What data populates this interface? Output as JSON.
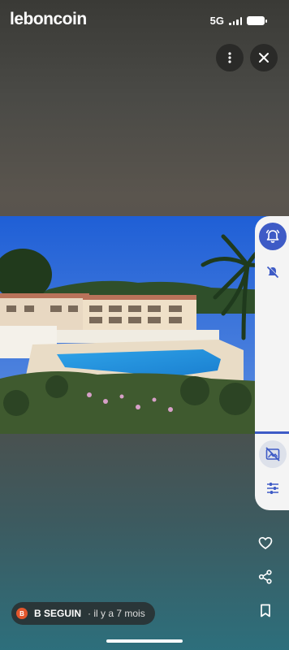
{
  "status_bar": {
    "app_brand": "leboncoin",
    "network": "5G",
    "signal_icon": "signal-bars-icon",
    "battery_icon": "battery-icon"
  },
  "top_controls": {
    "more_icon": "more-vertical-icon",
    "close_icon": "close-icon"
  },
  "photo": {
    "subject": "residence-pool-photo",
    "icon": "photo-image"
  },
  "side_rail": {
    "buttons": [
      {
        "icon": "bell-alarm-icon",
        "active": true
      },
      {
        "icon": "mute-off-icon",
        "active": false
      },
      {
        "icon": "no-image-icon",
        "active": false
      },
      {
        "icon": "sliders-icon",
        "active": false
      }
    ],
    "accent_color": "#3e5bc6"
  },
  "actions": {
    "like_icon": "heart-icon",
    "share_icon": "share-icon",
    "save_icon": "bookmark-icon"
  },
  "author": {
    "initial": "B",
    "name": "B SEGUIN",
    "time_ago": "· il y a 7 mois",
    "avatar_color": "#e2562c"
  }
}
